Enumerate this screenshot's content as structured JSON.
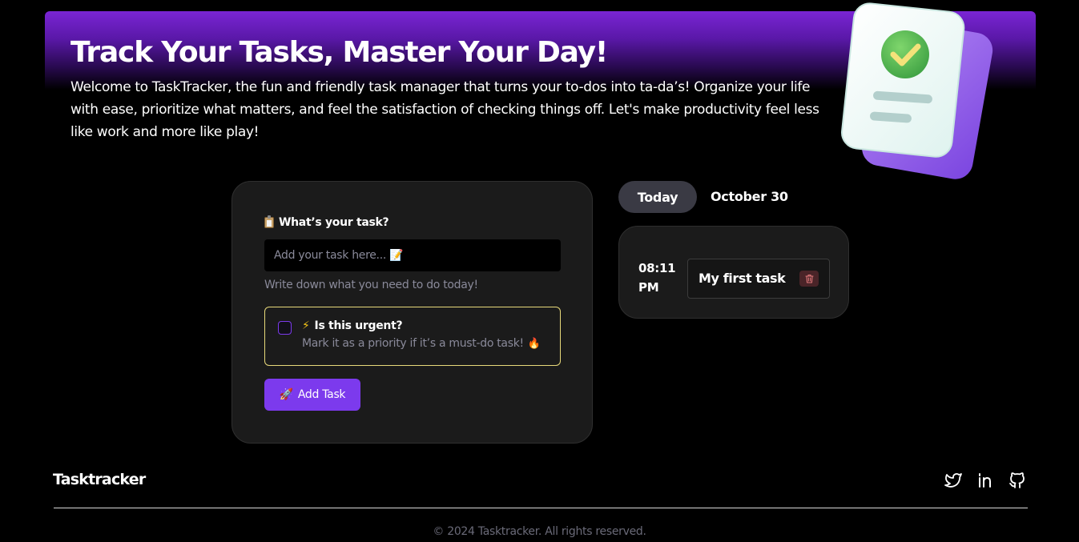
{
  "hero": {
    "title": "Track Your Tasks, Master Your Day!",
    "description": "Welcome to TaskTracker, the fun and friendly task manager that turns your to-dos into ta-da’s! Organize your life with ease, prioritize what matters, and feel the satisfaction of checking things off. Let's make productivity feel less like work and more like play!"
  },
  "form": {
    "label": "What’s your task?",
    "label_icon": "clipboard-icon",
    "input_value": "",
    "input_placeholder": "Add your task here... 📝",
    "hint": "Write down what you need to do today!",
    "urgent_title": "Is this urgent?",
    "urgent_icon": "lightning-icon",
    "urgent_checked": false,
    "urgent_desc": "Mark it as a priority if it’s a must-do task!",
    "urgent_desc_icon": "fire-icon",
    "add_button_label": "Add Task",
    "add_button_icon": "rocket-icon"
  },
  "schedule": {
    "day_label": "Today",
    "date": "October 30",
    "tasks": [
      {
        "time": "08:11 PM",
        "name": "My first task",
        "delete_icon": "trash-icon"
      }
    ]
  },
  "footer": {
    "brand": "Tasktracker",
    "social": [
      "twitter-icon",
      "linkedin-icon",
      "github-icon"
    ],
    "copyright": "© 2024 Tasktracker. All rights reserved."
  },
  "colors": {
    "background": "#000000",
    "accent": "#7c3aed",
    "card": "#1b1b1b",
    "urgent_border": "#e8d97a",
    "muted_text": "#8a8a9a"
  }
}
